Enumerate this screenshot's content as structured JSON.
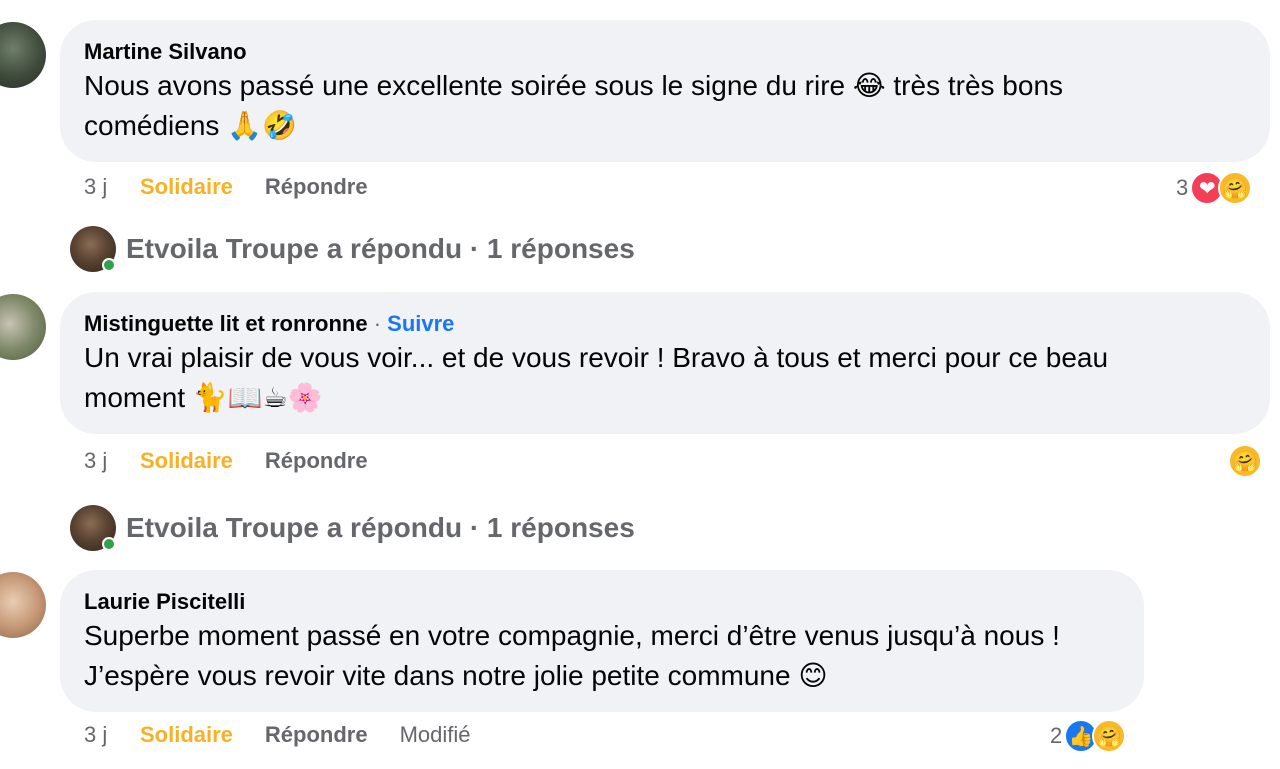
{
  "comments": [
    {
      "author": "Martine Silvano",
      "text_line1": "Nous avons passé une excellente soirée sous le signe du rire 😂 très très bons",
      "text_line2": "comédiens 🙏🤣",
      "age": "3 j",
      "solidaire": "Solidaire",
      "reply": "Répondre",
      "reaction_count": "3",
      "reaction_icons": [
        "love-icon",
        "care-icon"
      ]
    },
    {
      "author": "Mistinguette lit et ronronne",
      "follow": "Suivre",
      "dot": "·",
      "text_line1": "Un vrai plaisir de vous voir... et de vous revoir ! Bravo à tous et merci pour ce beau",
      "text_line2": "moment 🐈📖☕🌸",
      "age": "3 j",
      "solidaire": "Solidaire",
      "reply": "Répondre",
      "reaction_icons": [
        "care-icon"
      ]
    },
    {
      "author": "Laurie Piscitelli",
      "text_line1": "Superbe moment passé en votre compagnie, merci d’être venus jusqu’à nous !",
      "text_line2": "J’espère vous revoir vite dans notre jolie petite commune 😊",
      "age": "3 j",
      "solidaire": "Solidaire",
      "reply": "Répondre",
      "edited": "Modifié",
      "reaction_count": "2",
      "reaction_icons": [
        "like-icon",
        "care-icon"
      ]
    }
  ],
  "replies": [
    {
      "label": "Etvoila Troupe a répondu · 1 réponses"
    },
    {
      "label": "Etvoila Troupe a répondu · 1 réponses"
    }
  ],
  "icons": {
    "love": "❤",
    "care": "🤗",
    "like": "👍"
  },
  "colors": {
    "bubble": "#f0f2f5",
    "solidaire": "#f7b125",
    "follow": "#1877f2",
    "muted": "#65676b"
  }
}
